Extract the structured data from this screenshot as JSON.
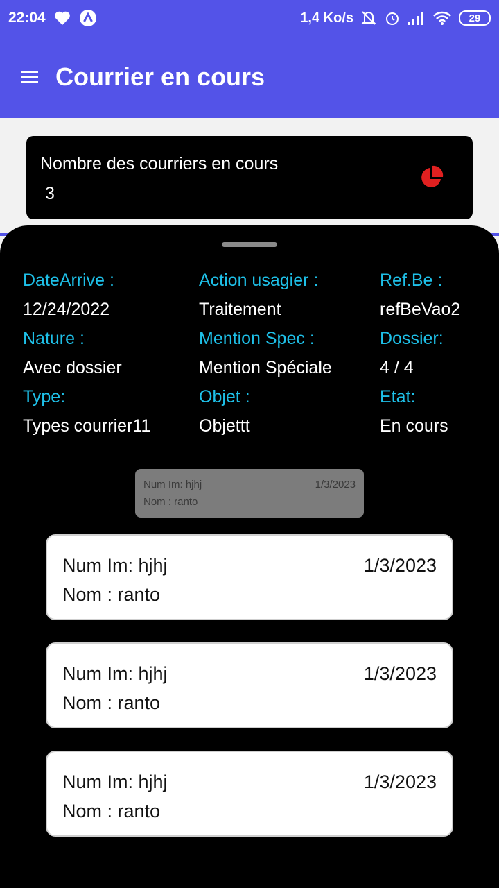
{
  "status_bar": {
    "time": "22:04",
    "speed": "1,4 Ko/s",
    "battery": "29",
    "icons": [
      "heart-icon",
      "app-icon",
      "mute-icon",
      "alarm-icon",
      "signal-icon",
      "wifi-icon",
      "battery-icon"
    ]
  },
  "app_bar": {
    "title": "Courrier en cours",
    "menu_icon": "hamburger-menu-icon"
  },
  "count_card": {
    "label": "Nombre des courriers en cours",
    "value": "3",
    "icon": "pie-chart-icon",
    "icon_color": "#e02020"
  },
  "details": {
    "date_arrive": {
      "label": "DateArrive :",
      "value": "12/24/2022"
    },
    "action_usagier": {
      "label": "Action usagier :",
      "value": "Traitement"
    },
    "ref_be": {
      "label": "Ref.Be :",
      "value": "refBeVao2"
    },
    "nature": {
      "label": "Nature :",
      "value": "Avec dossier"
    },
    "mention_spec": {
      "label": "Mention Spec :",
      "value": "Mention Spéciale"
    },
    "dossier": {
      "label": "Dossier:",
      "value": "4 / 4"
    },
    "type": {
      "label": "Type:",
      "value": "Types courrier11"
    },
    "objet": {
      "label": "Objet :",
      "value": "Objettt"
    },
    "etat": {
      "label": "Etat:",
      "value": "En cours"
    }
  },
  "ghost_card": {
    "num": "Num Im: hjhj",
    "date": "1/3/2023",
    "nom": "Nom : ranto"
  },
  "items": [
    {
      "num": "Num Im: hjhj",
      "date": "1/3/2023",
      "nom": "Nom : ranto"
    },
    {
      "num": "Num Im: hjhj",
      "date": "1/3/2023",
      "nom": "Nom : ranto"
    },
    {
      "num": "Num Im: hjhj",
      "date": "1/3/2023",
      "nom": "Nom : ranto"
    }
  ],
  "colors": {
    "primary": "#5353e8",
    "label_accent": "#1ec0e8",
    "sheet_bg": "#000000"
  }
}
